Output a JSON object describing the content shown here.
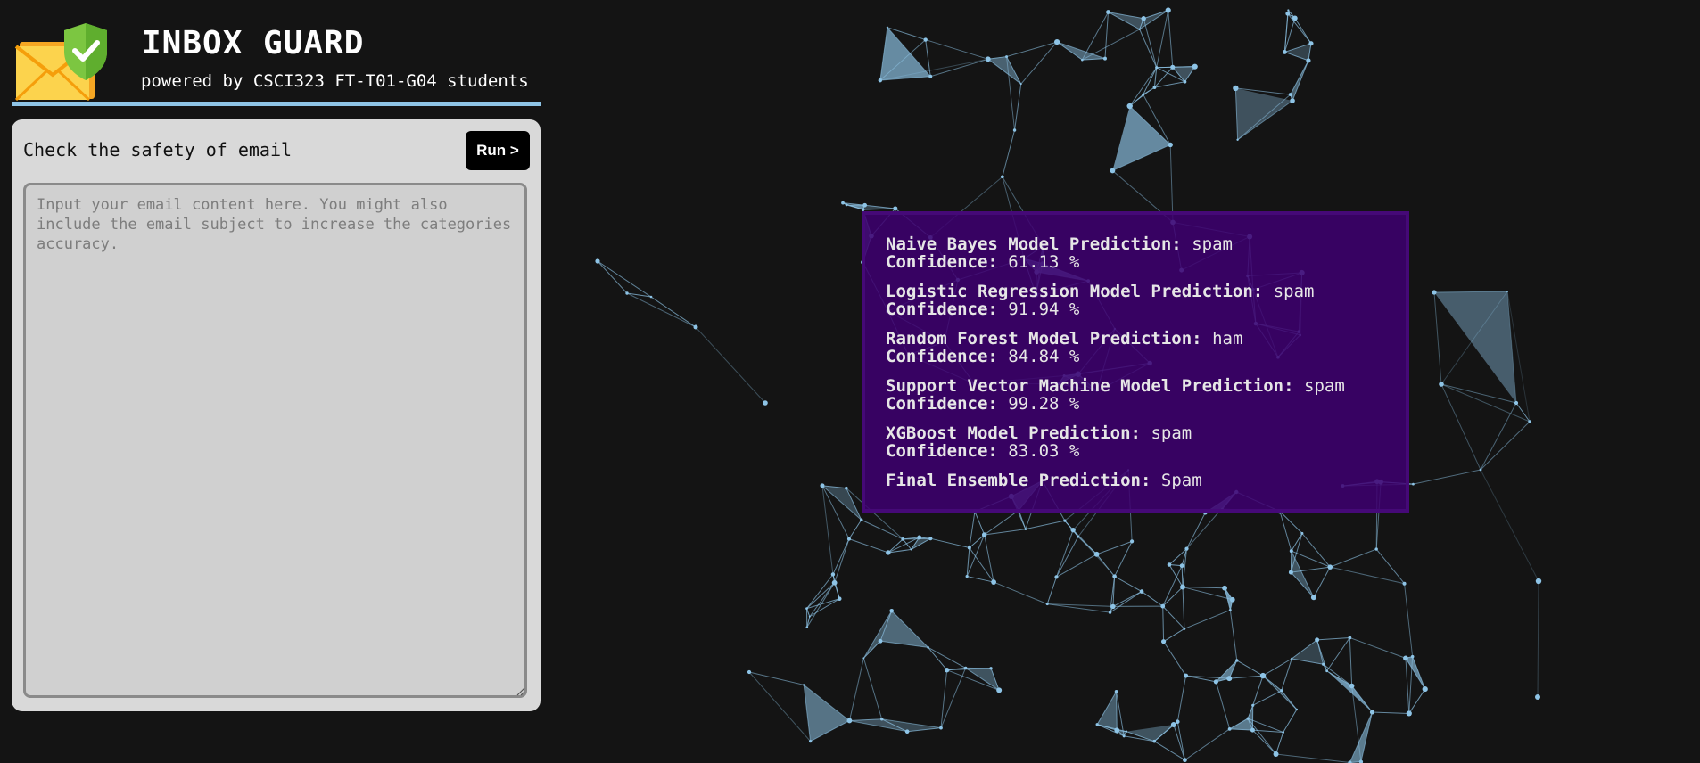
{
  "header": {
    "title": "INBOX GUARD",
    "subtitle": "powered by CSCI323 FT-T01-G04 students",
    "logo_icon": "envelope-shield-check-icon"
  },
  "checker": {
    "title": "Check the safety of email",
    "run_label": "Run >",
    "input_value": "",
    "input_placeholder": "Input your email content here. You might also include the email subject to increase the categories accuracy."
  },
  "results": [
    {
      "model_label": "Naive Bayes Model Prediction:",
      "prediction": "spam",
      "confidence_label": "Confidence:",
      "confidence": "61.13 %"
    },
    {
      "model_label": "Logistic Regression Model Prediction:",
      "prediction": "spam",
      "confidence_label": "Confidence:",
      "confidence": "91.94 %"
    },
    {
      "model_label": "Random Forest Model Prediction:",
      "prediction": "ham",
      "confidence_label": "Confidence:",
      "confidence": "84.84 %"
    },
    {
      "model_label": "Support Vector Machine Model Prediction:",
      "prediction": "spam",
      "confidence_label": "Confidence:",
      "confidence": "99.28 %"
    },
    {
      "model_label": "XGBoost Model Prediction:",
      "prediction": "spam",
      "confidence_label": "Confidence:",
      "confidence": "83.03 %"
    }
  ],
  "final": {
    "label": "Final Ensemble Prediction:",
    "value": "Spam"
  },
  "colors": {
    "background": "#141414",
    "panel": "#d9d9d9",
    "accent_line": "#8ec4e6",
    "network": "#8ec4e6",
    "results_bg": "#3e0070"
  }
}
